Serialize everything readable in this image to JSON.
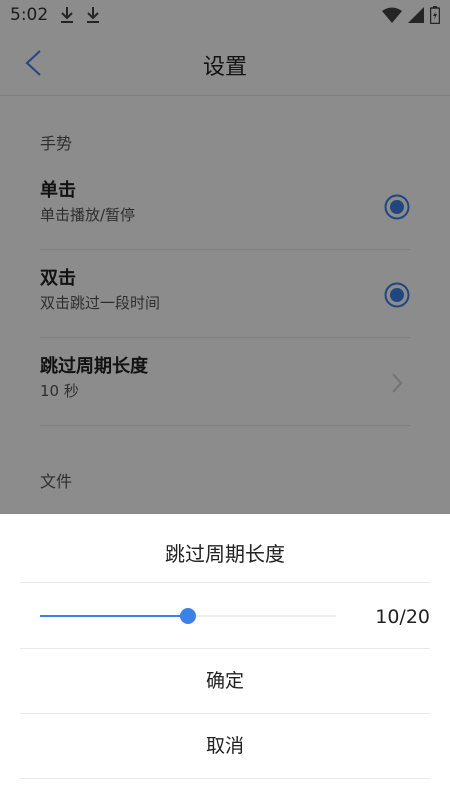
{
  "status_bar": {
    "time": "5:02",
    "icons": [
      "download-icon",
      "download-icon",
      "wifi-icon",
      "signal-icon",
      "battery-icon"
    ]
  },
  "header": {
    "title": "设置",
    "back_icon": "chevron-left-icon",
    "accent": "#3b82e8"
  },
  "sections": {
    "gestures": "手势",
    "files": "文件"
  },
  "rows": [
    {
      "title": "单击",
      "subtitle": "单击播放/暂停",
      "control": "radio",
      "checked": true
    },
    {
      "title": "双击",
      "subtitle": "双击跳过一段时间",
      "control": "radio",
      "checked": true
    },
    {
      "title": "跳过周期长度",
      "subtitle": "10 秒",
      "control": "chevron"
    }
  ],
  "dialog": {
    "title": "跳过周期长度",
    "slider": {
      "value": 10,
      "max": 20,
      "display": "10/20"
    },
    "confirm": "确定",
    "cancel": "取消"
  }
}
